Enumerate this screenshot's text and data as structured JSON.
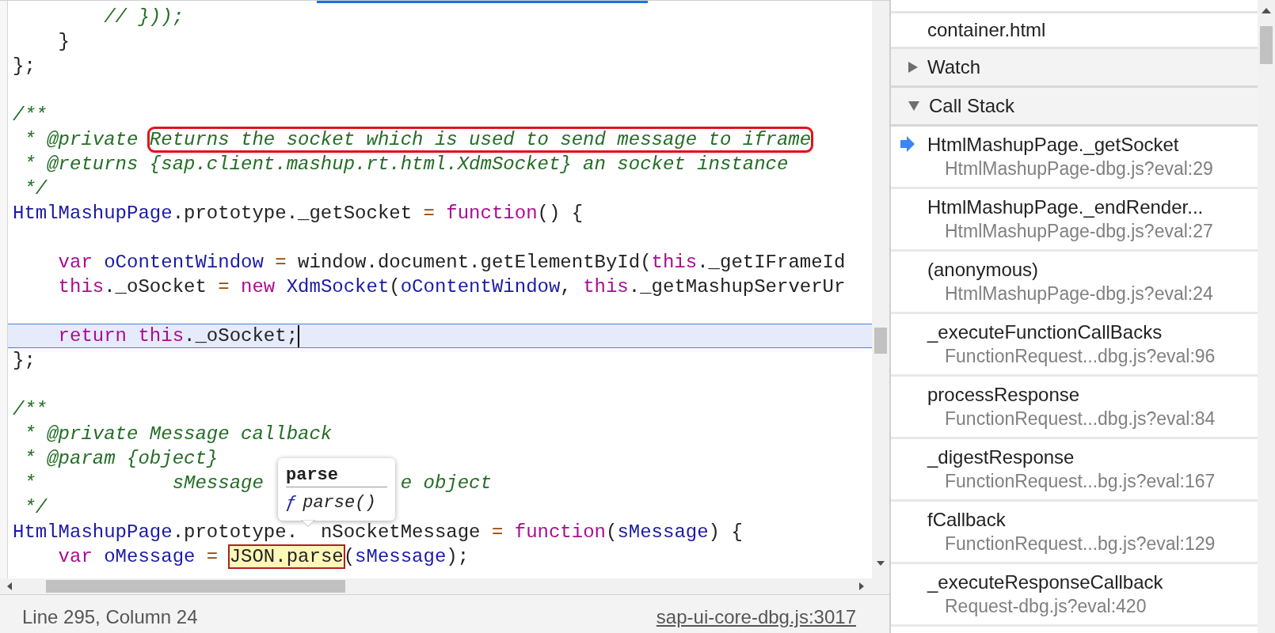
{
  "editor": {
    "code_lines": [
      {
        "current": false,
        "segments": [
          {
            "tokens": [
              {
                "kind": "comment",
                "text": "        // }));"
              }
            ]
          }
        ]
      },
      {
        "current": false,
        "segments": [
          {
            "tokens": [
              {
                "kind": "plain",
                "text": "    }"
              }
            ]
          }
        ]
      },
      {
        "current": false,
        "segments": [
          {
            "tokens": [
              {
                "kind": "plain",
                "text": "};"
              }
            ]
          }
        ]
      },
      {
        "current": false
      },
      {
        "current": false,
        "segments": [
          {
            "tokens": [
              {
                "kind": "comment",
                "text": "/**"
              }
            ]
          }
        ]
      },
      {
        "current": false,
        "segments": [
          {
            "tokens": [
              {
                "kind": "comment",
                "text": " * @private "
              },
              {
                "kind": "comment",
                "text": "Returns the socket which is used to send message to iframe",
                "boxed": true
              }
            ]
          }
        ]
      },
      {
        "current": false,
        "segments": [
          {
            "tokens": [
              {
                "kind": "comment",
                "text": " * @returns {sap.client.mashup.rt.html.XdmSocket} an socket instance"
              }
            ]
          }
        ]
      },
      {
        "current": false,
        "segments": [
          {
            "tokens": [
              {
                "kind": "comment",
                "text": " */"
              }
            ]
          }
        ]
      },
      {
        "current": false,
        "segments": [
          {
            "tokens": [
              {
                "kind": "ident",
                "text": "HtmlMashupPage"
              },
              {
                "kind": "plain",
                "text": ".prototype._getSocket "
              },
              {
                "kind": "op",
                "text": "= "
              },
              {
                "kind": "keyword",
                "text": "function"
              },
              {
                "kind": "plain",
                "text": "() {"
              }
            ]
          }
        ]
      },
      {
        "current": false
      },
      {
        "current": false,
        "segments": [
          {
            "tokens": [
              {
                "kind": "keyword",
                "text": "    var "
              },
              {
                "kind": "ident",
                "text": "oContentWindow "
              },
              {
                "kind": "op",
                "text": "= "
              },
              {
                "kind": "plain",
                "text": "window.document.getElementById("
              },
              {
                "kind": "keyword",
                "text": "this"
              },
              {
                "kind": "plain",
                "text": "._getIFrameId"
              }
            ]
          }
        ]
      },
      {
        "current": false,
        "segments": [
          {
            "tokens": [
              {
                "kind": "keyword",
                "text": "    this"
              },
              {
                "kind": "plain",
                "text": "._oSocket "
              },
              {
                "kind": "op",
                "text": "= "
              },
              {
                "kind": "keyword",
                "text": "new "
              },
              {
                "kind": "ident",
                "text": "XdmSocket"
              },
              {
                "kind": "plain",
                "text": "("
              },
              {
                "kind": "ident",
                "text": "oContentWindow"
              },
              {
                "kind": "plain",
                "text": ", "
              },
              {
                "kind": "keyword",
                "text": "this"
              },
              {
                "kind": "plain",
                "text": "._getMashupServerUr"
              }
            ]
          }
        ]
      },
      {
        "current": false
      },
      {
        "current": true,
        "segments": [
          {
            "tokens": [
              {
                "kind": "keyword",
                "text": "    return this"
              },
              {
                "kind": "plain",
                "text": "._oSocket;"
              }
            ]
          }
        ]
      },
      {
        "current": false,
        "segments": [
          {
            "tokens": [
              {
                "kind": "plain",
                "text": "};"
              }
            ]
          }
        ]
      },
      {
        "current": false
      },
      {
        "current": false,
        "segments": [
          {
            "tokens": [
              {
                "kind": "comment",
                "text": "/**"
              }
            ]
          }
        ]
      },
      {
        "current": false,
        "segments": [
          {
            "tokens": [
              {
                "kind": "comment",
                "text": " * @private Message callback"
              }
            ]
          }
        ]
      },
      {
        "current": false,
        "segments": [
          {
            "tokens": [
              {
                "kind": "comment",
                "text": " * @param {object}"
              }
            ]
          }
        ]
      },
      {
        "current": false,
        "segments": [
          {
            "tokens": [
              {
                "kind": "comment",
                "text": " *            sMessage"
              }
            ]
          },
          {
            "tokens": [
              {
                "kind": "comment",
                "text": "            e object"
              }
            ]
          }
        ]
      },
      {
        "current": false,
        "segments": [
          {
            "tokens": [
              {
                "kind": "comment",
                "text": " */"
              }
            ]
          }
        ]
      },
      {
        "current": false,
        "segments": [
          {
            "tokens": [
              {
                "kind": "ident",
                "text": "HtmlMashupPage"
              },
              {
                "kind": "plain",
                "text": ".prototype."
              }
            ]
          },
          {
            "tokens": [
              {
                "kind": "plain",
                "text": "  nSocketMessage "
              },
              {
                "kind": "op",
                "text": "= "
              },
              {
                "kind": "keyword",
                "text": "function"
              },
              {
                "kind": "plain",
                "text": "("
              },
              {
                "kind": "ident",
                "text": "sMessage"
              },
              {
                "kind": "plain",
                "text": ") {"
              }
            ]
          }
        ]
      },
      {
        "current": false,
        "segments": [
          {
            "tokens": [
              {
                "kind": "keyword",
                "text": "    var "
              },
              {
                "kind": "ident",
                "text": "oMessage "
              },
              {
                "kind": "op",
                "text": "= "
              },
              {
                "kind": "plain",
                "text": "JSON.parse",
                "highlighted": true
              },
              {
                "kind": "plain",
                "text": "("
              },
              {
                "kind": "ident",
                "text": "sMessage"
              },
              {
                "kind": "plain",
                "text": ");"
              }
            ]
          }
        ]
      }
    ],
    "tooltip": {
      "title": "parse",
      "icon": "ƒ",
      "signature": "parse()"
    }
  },
  "status_bar": {
    "position": "Line 295, Column 24",
    "source_link": "sap-ui-core-dbg.js:3017"
  },
  "debugger_panel": {
    "sections": [
      {
        "kind": "thread",
        "label": "container.html"
      },
      {
        "kind": "header",
        "label": "Watch",
        "expanded": false
      },
      {
        "kind": "header",
        "label": "Call Stack",
        "expanded": true
      }
    ],
    "call_stack": [
      {
        "name": "HtmlMashupPage._getSocket",
        "location": "HtmlMashupPage-dbg.js?eval:29",
        "current": true
      },
      {
        "name": "HtmlMashupPage._endRender...",
        "location": "HtmlMashupPage-dbg.js?eval:27",
        "current": false
      },
      {
        "name": "(anonymous)",
        "location": "HtmlMashupPage-dbg.js?eval:24",
        "current": false
      },
      {
        "name": "_executeFunctionCallBacks",
        "location": "FunctionRequest...dbg.js?eval:96",
        "current": false
      },
      {
        "name": "processResponse",
        "location": "FunctionRequest...dbg.js?eval:84",
        "current": false
      },
      {
        "name": "_digestResponse",
        "location": "FunctionRequest...bg.js?eval:167",
        "current": false
      },
      {
        "name": "fCallback",
        "location": "FunctionRequest...bg.js?eval:129",
        "current": false
      },
      {
        "name": "_executeResponseCallback",
        "location": "Request-dbg.js?eval:420",
        "current": false
      }
    ]
  }
}
